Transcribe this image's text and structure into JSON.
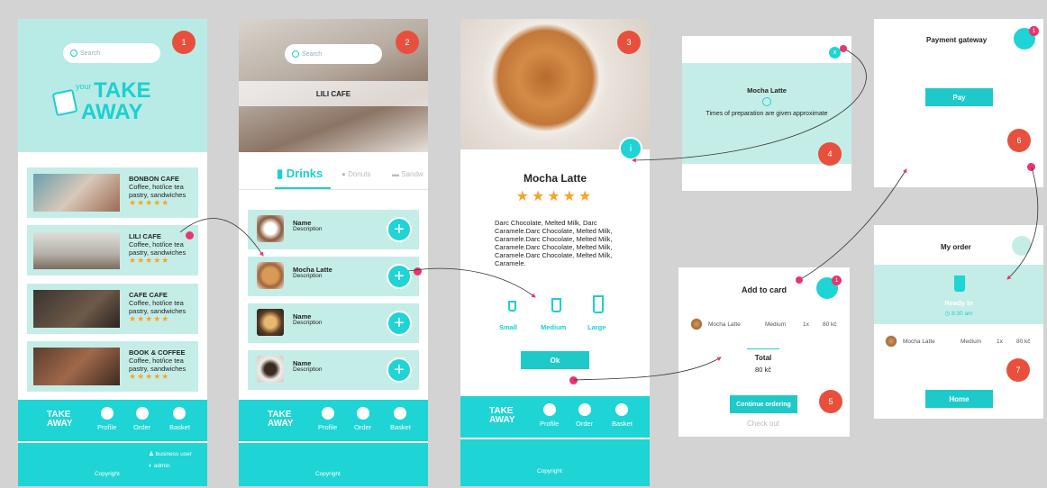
{
  "screen1": {
    "badge": "1",
    "search_placeholder": "Search",
    "logo_your": "your",
    "logo_take": "TAKE",
    "logo_away": "AWAY",
    "cafes": [
      {
        "name": "BONBON CAFE",
        "desc1": "Coffee, hot/ice tea",
        "desc2": "pastry, sandwiches",
        "stars": "★★★★★"
      },
      {
        "name": "LILI CAFE",
        "desc1": "Coffee, hot/ice tea",
        "desc2": "pastry, sandwiches",
        "stars": "★★★★★"
      },
      {
        "name": "CAFE CAFE",
        "desc1": "Coffee, hot/ice tea",
        "desc2": "pastry, sandwiches",
        "stars": "★★★★★"
      },
      {
        "name": "BOOK & COFFEE",
        "desc1": "Coffee, hot/ice tea",
        "desc2": "pastry, sandwiches",
        "stars": "★★★★★"
      }
    ],
    "business_user": "business user",
    "admin": "admin",
    "copyright": "Copyright"
  },
  "nav": {
    "logo_take": "TAKE",
    "logo_away": "AWAY",
    "profile": "Profile",
    "order": "Order",
    "basket": "Basket"
  },
  "screen2": {
    "badge": "2",
    "search_placeholder": "Search",
    "cafe_name": "LILI CAFE",
    "tab_drinks": "Drinks",
    "tab_donuts": "Donuts",
    "tab_sandw": "Sandw",
    "drinks": [
      {
        "name": "Name",
        "desc": "Description"
      },
      {
        "name": "Mocha Latte",
        "desc": "Description"
      },
      {
        "name": "Name",
        "desc": "Description"
      },
      {
        "name": "Name",
        "desc": "Description"
      }
    ],
    "plus": "+",
    "copyright": "Copyright"
  },
  "screen3": {
    "badge": "3",
    "info": "i",
    "title": "Mocha Latte",
    "stars": "★★★★★",
    "desc_l1": "Darc Chocolate, Melted Milk, Darc",
    "desc_l2": "Caramele.Darc Chocolate, Melted Milk,",
    "desc_l3": "Caramele.Darc Chocolate, Melted Milk,",
    "desc_l4": "Caramele.Darc Chocolate, Melted Milk,",
    "desc_l5": "Caramele.Darc Chocolate, Melted Milk,",
    "desc_l6": "Caramele.",
    "size_small": "Small",
    "size_medium": "Medium",
    "size_large": "Large",
    "ok": "Ok",
    "copyright": "Copyright"
  },
  "screen4": {
    "badge": "4",
    "close": "x",
    "title": "Mocha Latte",
    "note": "Times of preparation are given approximate"
  },
  "screen5": {
    "badge": "5",
    "title": "Add to card",
    "basket_count": "1",
    "item": "Mocha Latte",
    "size": "Medium",
    "qty": "1x",
    "price": "80 kč",
    "total_label": "Total",
    "total_value": "80 kč",
    "continue": "Continue ordering",
    "checkout": "Check out"
  },
  "screen6": {
    "badge": "6",
    "title": "Payment gateway",
    "basket_count": "1",
    "pay": "Pay"
  },
  "screen7": {
    "badge": "7",
    "title": "My order",
    "ready": "Ready in",
    "time": "8:30 am",
    "item": "Mocha Latte",
    "size": "Medium",
    "qty": "1x",
    "price": "80 kč",
    "home": "Home"
  },
  "colors": {
    "teal": "#1ed4d4",
    "mint": "#c5ede8",
    "badge": "#e8503d",
    "star": "#f5a623",
    "connector": "#e8356f"
  }
}
